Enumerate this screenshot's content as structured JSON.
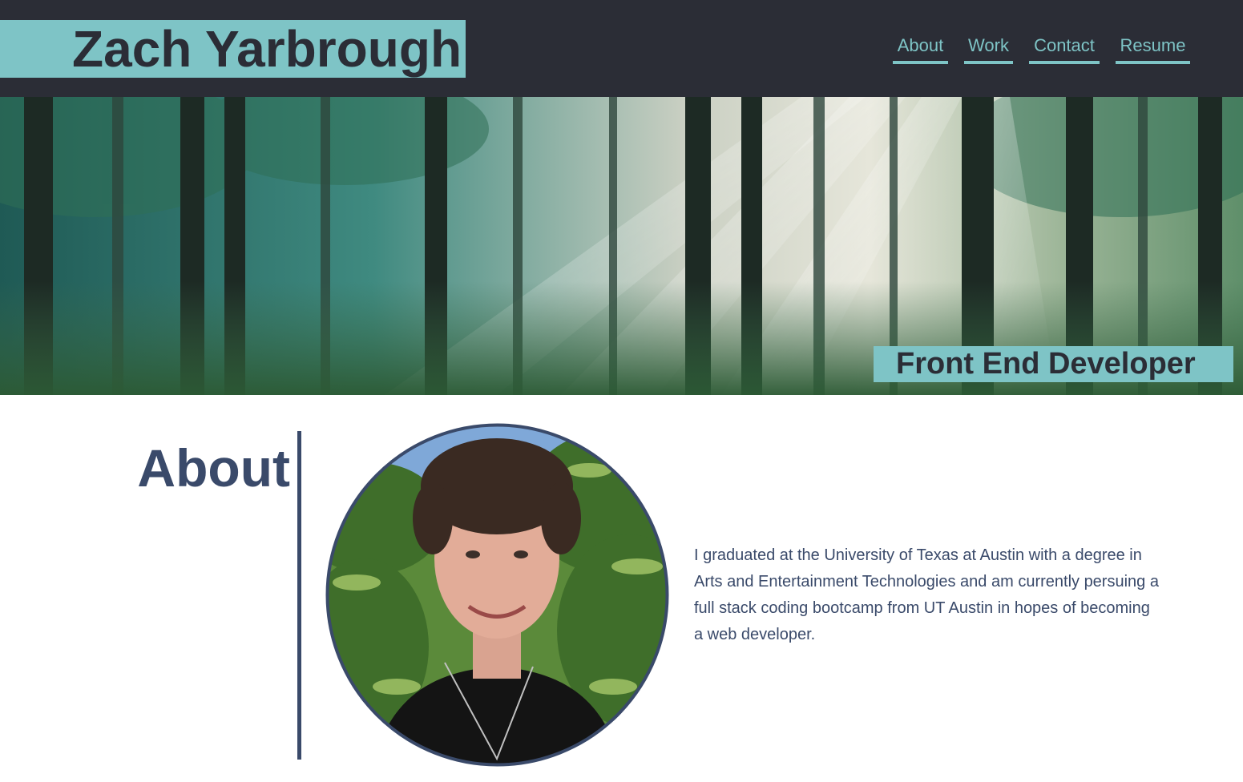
{
  "header": {
    "name": "Zach Yarbrough",
    "nav": [
      {
        "label": "About"
      },
      {
        "label": "Work"
      },
      {
        "label": "Contact"
      },
      {
        "label": "Resume"
      }
    ]
  },
  "hero": {
    "tagline": "Front End Developer",
    "image": "forest-sunbeams-photo"
  },
  "about": {
    "title": "About",
    "photo": "portrait-photo",
    "bio": "I graduated at the University of Texas at Austin with a degree in Arts and Entertainment Technologies and am currently persuing a full stack coding bootcamp from UT Austin in hopes of becoming a web developer."
  },
  "colors": {
    "header_bg": "#2b2d36",
    "accent": "#7ec4c6",
    "text_dark": "#3a4a6a"
  }
}
